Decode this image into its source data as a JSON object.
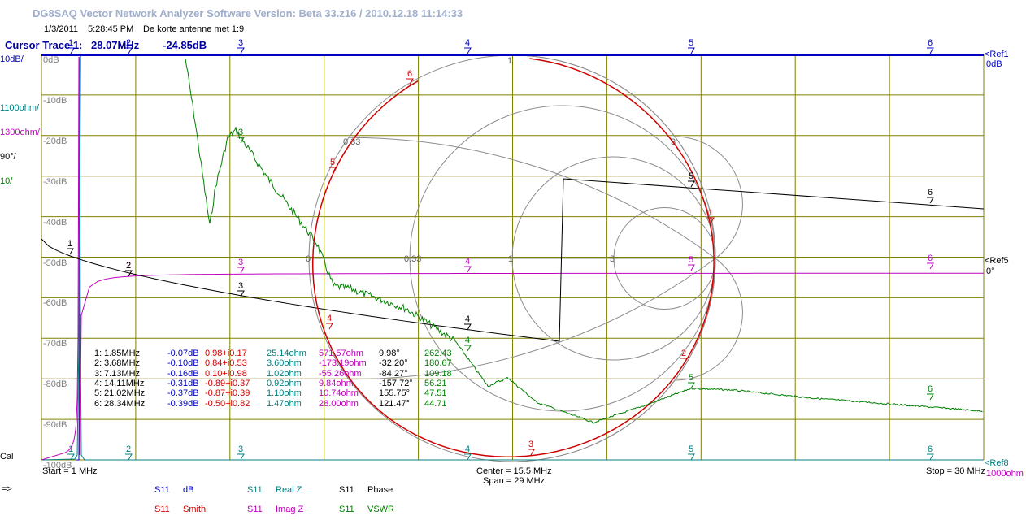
{
  "window": {
    "title": "DG8SAQ Vector Network Analyzer Software   Version:  Beta 33.z16 / 2010.12.18 11:14:33"
  },
  "header": {
    "date": "1/3/2011",
    "time": "5:28:45 PM",
    "description": "De korte antenne met 1:9"
  },
  "cursor": {
    "label": "Cursor Trace 1:",
    "freq": "28.07MHz",
    "value": "-24.85dB"
  },
  "scales": {
    "db": "10dB/",
    "realz": "1100ohm/",
    "imagz": "1300ohm/",
    "phase": "90°/",
    "vswr": "10/",
    "cal": "Cal",
    "ref1": "<Ref1",
    "ref1_val": "0dB",
    "ref5": "<Ref5",
    "ref5_val": "0°",
    "ref_bottom": "<Ref8",
    "ref_bottom_val": "1000ohm"
  },
  "y_ticks": [
    "0dB",
    "-10dB",
    "-20dB",
    "-30dB",
    "-40dB",
    "-50dB",
    "-60dB",
    "-70dB",
    "-80dB",
    "-90dB",
    "-100dB"
  ],
  "x_axis": {
    "start": "Start = 1 MHz",
    "center": "Center = 15.5 MHz",
    "span": "Span = 29 MHz",
    "stop": "Stop = 30 MHz"
  },
  "smith_labels": {
    "zero": "0",
    "r033": "0.33",
    "r1": "1",
    "r3": "3",
    "top1": "1",
    "x033": "0.33",
    "x3": "3"
  },
  "markers": [
    {
      "n": "1",
      "freq": "1.85MHz",
      "db": "-0.07dB",
      "smith": "0.98+i0.17",
      "realz": "25.14ohm",
      "imagz": "571.57ohm",
      "phase": "9.98°",
      "vswr": "262.43"
    },
    {
      "n": "2",
      "freq": "3.68MHz",
      "db": "-0.10dB",
      "smith": "0.84+i0.53",
      "realz": "3.60ohm",
      "imagz": "-173.19ohm",
      "phase": "-32.20°",
      "vswr": "180.67"
    },
    {
      "n": "3",
      "freq": "7.13MHz",
      "db": "-0.16dB",
      "smith": "0.10+i0.98",
      "realz": "1.02ohm",
      "imagz": "-55.26ohm",
      "phase": "-84.27°",
      "vswr": "109.18"
    },
    {
      "n": "4",
      "freq": "14.11MHz",
      "db": "-0.31dB",
      "smith": "-0.89+i0.37",
      "realz": "0.92ohm",
      "imagz": "9.84ohm",
      "phase": "-157.72°",
      "vswr": "56.21"
    },
    {
      "n": "5",
      "freq": "21.02MHz",
      "db": "-0.37dB",
      "smith": "-0.87+i0.39",
      "realz": "1.10ohm",
      "imagz": "10.74ohm",
      "phase": "155.75°",
      "vswr": "47.51"
    },
    {
      "n": "6",
      "freq": "28.34MHz",
      "db": "-0.39dB",
      "smith": "-0.50+i0.82",
      "realz": "1.47ohm",
      "imagz": "28.00ohm",
      "phase": "121.47°",
      "vswr": "44.71"
    }
  ],
  "marker_nums": [
    "1",
    "2",
    "3",
    "4",
    "5",
    "6"
  ],
  "prompt": "=>",
  "legend": [
    {
      "param": "S11",
      "name": "dB",
      "color": "#0000c0"
    },
    {
      "param": "S11",
      "name": "Smith",
      "color": "#d00000"
    },
    {
      "param": "S11",
      "name": "Real Z",
      "color": "#008080"
    },
    {
      "param": "S11",
      "name": "Imag Z",
      "color": "#c000c0"
    },
    {
      "param": "S11",
      "name": "Phase",
      "color": "#000000"
    },
    {
      "param": "S11",
      "name": "VSWR",
      "color": "#008000"
    }
  ],
  "colors": {
    "grid": "#808000",
    "db": "#0000c0",
    "smith": "#d00000",
    "realz": "#008080",
    "imagz": "#c000c0",
    "phase": "#000000",
    "vswr": "#008000",
    "smithgrid": "#8c8c8c"
  }
}
